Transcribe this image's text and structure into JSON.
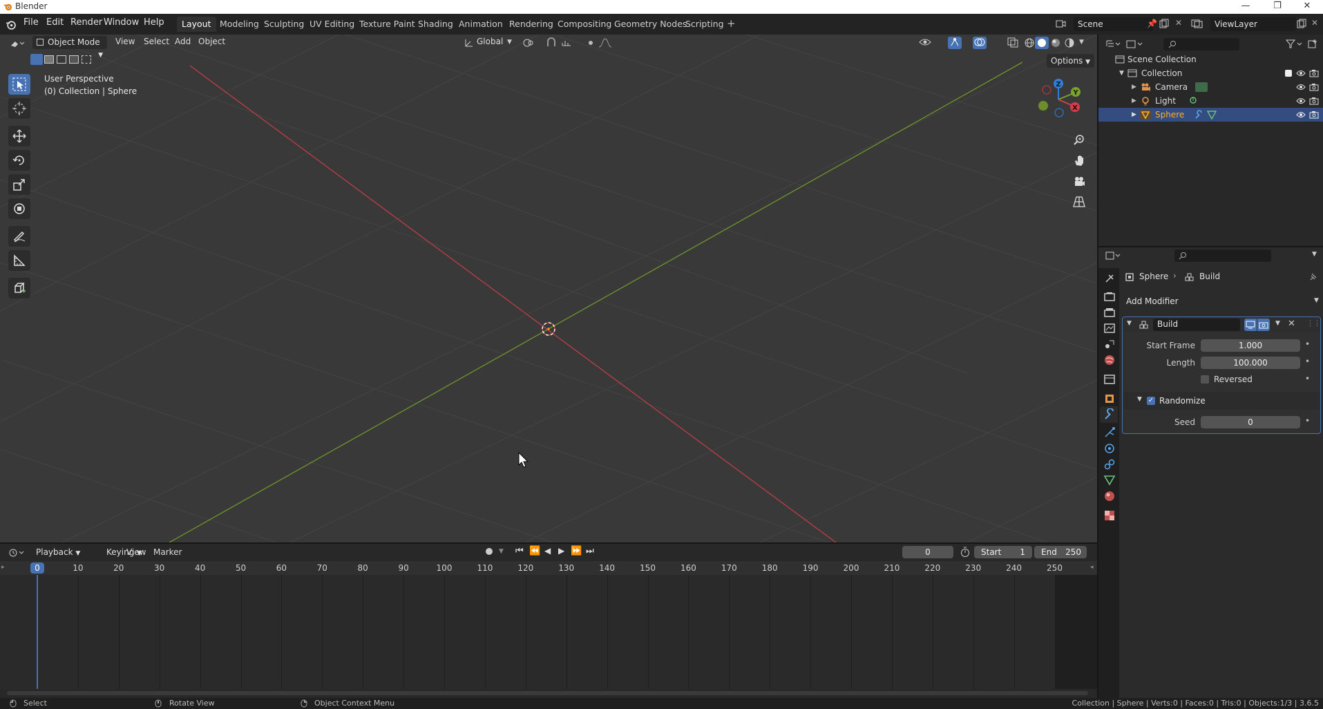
{
  "window": {
    "title": "Blender"
  },
  "menu": [
    "File",
    "Edit",
    "Render",
    "Window",
    "Help"
  ],
  "workspaces": [
    "Layout",
    "Modeling",
    "Sculpting",
    "UV Editing",
    "Texture Paint",
    "Shading",
    "Animation",
    "Rendering",
    "Compositing",
    "Geometry Nodes",
    "Scripting"
  ],
  "active_workspace": "Layout",
  "scene": {
    "name": "Scene",
    "view_layer": "ViewLayer"
  },
  "viewport": {
    "mode": "Object Mode",
    "menus": [
      "View",
      "Select",
      "Add",
      "Object"
    ],
    "transform_orientation": "Global",
    "options_label": "Options",
    "overlay_text": {
      "line1": "User Perspective",
      "line2": "(0) Collection | Sphere"
    },
    "gizmo_axes": {
      "x": "X",
      "y": "Y",
      "z": "Z"
    }
  },
  "outliner": {
    "root": "Scene Collection",
    "collection": "Collection",
    "items": [
      "Camera",
      "Light",
      "Sphere"
    ],
    "selected": "Sphere"
  },
  "properties": {
    "breadcrumb": {
      "object": "Sphere",
      "modifier": "Build"
    },
    "add_modifier_label": "Add Modifier",
    "modifier": {
      "name": "Build",
      "start_frame_label": "Start Frame",
      "start_frame_value": "1.000",
      "length_label": "Length",
      "length_value": "100.000",
      "reversed_label": "Reversed",
      "reversed": false,
      "randomize_label": "Randomize",
      "randomize": true,
      "seed_label": "Seed",
      "seed_value": "0"
    }
  },
  "timeline": {
    "menus": [
      "Playback",
      "Keying",
      "View",
      "Marker"
    ],
    "current_frame": "0",
    "start_label": "Start",
    "start_value": "1",
    "end_label": "End",
    "end_value": "250",
    "ruler": [
      "0",
      "10",
      "20",
      "30",
      "40",
      "50",
      "60",
      "70",
      "80",
      "90",
      "100",
      "110",
      "120",
      "130",
      "140",
      "150",
      "160",
      "170",
      "180",
      "190",
      "200",
      "210",
      "220",
      "230",
      "240",
      "250"
    ]
  },
  "statusbar": {
    "left": "Select",
    "middle": "Rotate View",
    "right": "Object Context Menu",
    "stats": "Collection | Sphere | Verts:0 | Faces:0 | Tris:0 | Objects:1/3 | 3.6.5"
  },
  "colors": {
    "accent": "#4772b3",
    "x_axis": "#d63c4c",
    "y_axis": "#7aa22e",
    "z_axis": "#2f7fd8",
    "selected_row": "#334d80",
    "active_object_text": "#ffaf29"
  }
}
